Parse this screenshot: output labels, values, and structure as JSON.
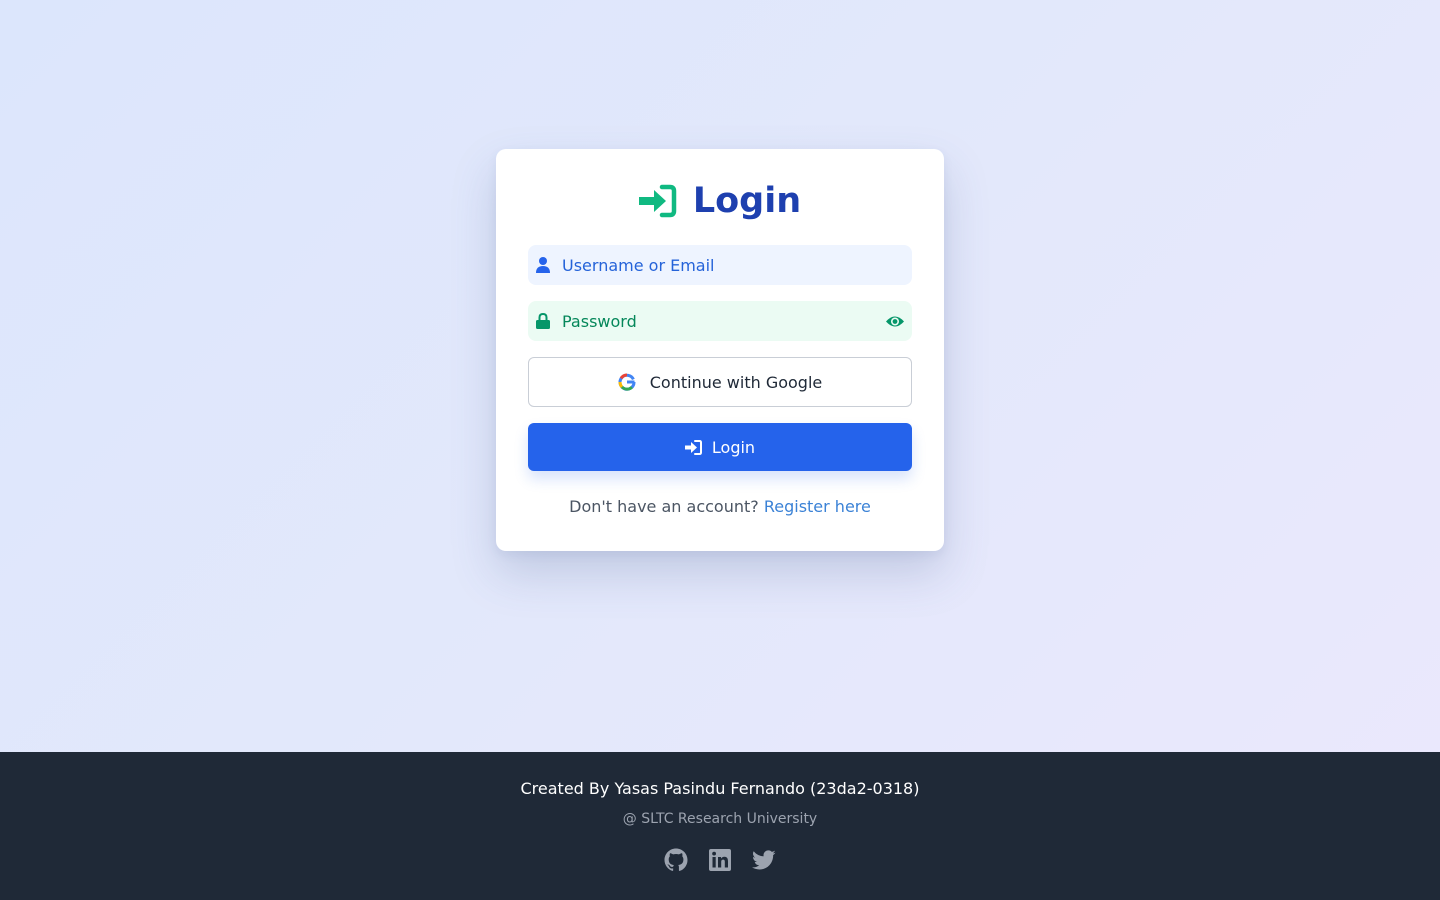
{
  "login_card": {
    "title": "Login",
    "title_icon": "sign-in-icon",
    "username_placeholder": "Username or Email",
    "username_icon": "user-icon",
    "password_placeholder": "Password",
    "password_icon": "lock-icon",
    "password_toggle_icon": "eye-icon",
    "google_label": "Continue with Google",
    "google_icon": "google-icon",
    "login_label": "Login",
    "login_icon": "sign-in-icon",
    "register_prompt": "Don't have an account?",
    "register_link": "Register here"
  },
  "footer": {
    "credit": "Created By Yasas Pasindu Fernando (23da2-0318)",
    "organization": "@ SLTC Research University",
    "social_icons": [
      "github-icon",
      "linkedin-icon",
      "twitter-icon"
    ]
  },
  "colors": {
    "primary": "#2563eb",
    "title": "#1e40af",
    "accent_green": "#10b981",
    "footer_bg": "#1f2937"
  }
}
